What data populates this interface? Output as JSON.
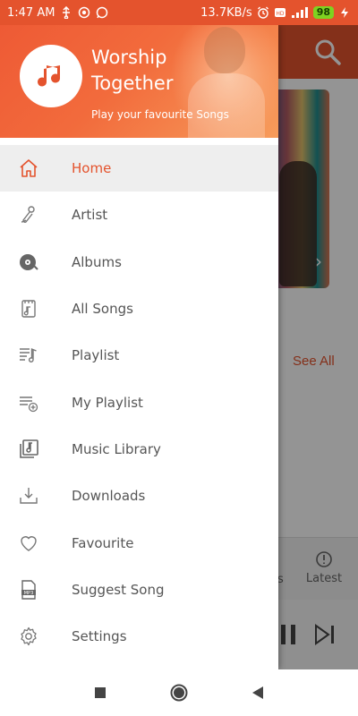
{
  "status_bar": {
    "time": "1:47 AM",
    "speed": "13.7KB/s",
    "battery": "98"
  },
  "app": {
    "see_all": "See All",
    "tab_partial": "s",
    "tab_latest": "Latest"
  },
  "drawer": {
    "title": "Worship Together",
    "subtitle": "Play your favourite Songs",
    "items": [
      {
        "label": "Home",
        "icon": "home-icon",
        "active": true
      },
      {
        "label": "Artist",
        "icon": "artist-icon"
      },
      {
        "label": "Albums",
        "icon": "album-icon"
      },
      {
        "label": "All Songs",
        "icon": "all-songs-icon"
      },
      {
        "label": "Playlist",
        "icon": "playlist-icon"
      },
      {
        "label": "My Playlist",
        "icon": "my-playlist-icon"
      },
      {
        "label": "Music Library",
        "icon": "music-library-icon"
      },
      {
        "label": "Downloads",
        "icon": "download-icon"
      },
      {
        "label": "Favourite",
        "icon": "heart-icon"
      },
      {
        "label": "Suggest Song",
        "icon": "mp3-file-icon"
      },
      {
        "label": "Settings",
        "icon": "gear-icon"
      }
    ]
  },
  "colors": {
    "accent": "#e4532d",
    "text": "#555555",
    "active_bg": "#eeeeee"
  }
}
